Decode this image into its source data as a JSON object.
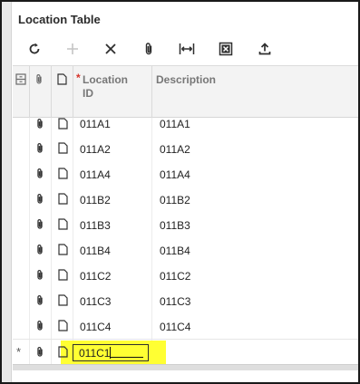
{
  "panel": {
    "title": "Location Table"
  },
  "toolbar": {
    "buttons": [
      {
        "name": "refresh-button",
        "icon": "refresh-icon",
        "enabled": true
      },
      {
        "name": "add-row-button",
        "icon": "plus-icon",
        "enabled": false
      },
      {
        "name": "delete-row-button",
        "icon": "close-icon",
        "enabled": true
      },
      {
        "name": "attach-button",
        "icon": "paperclip-icon",
        "enabled": true
      },
      {
        "name": "fit-columns-button",
        "icon": "fit-width-icon",
        "enabled": true
      },
      {
        "name": "export-excel-button",
        "icon": "excel-icon",
        "enabled": true
      },
      {
        "name": "upload-button",
        "icon": "upload-icon",
        "enabled": true
      }
    ]
  },
  "table": {
    "columns": {
      "location_id_line1": "Location",
      "location_id_line2": "ID",
      "description": "Description"
    },
    "rows": [
      {
        "location_id": "011A1",
        "description": "011A1"
      },
      {
        "location_id": "011A2",
        "description": "011A2"
      },
      {
        "location_id": "011A4",
        "description": "011A4"
      },
      {
        "location_id": "011B2",
        "description": "011B2"
      },
      {
        "location_id": "011B3",
        "description": "011B3"
      },
      {
        "location_id": "011B4",
        "description": "011B4"
      },
      {
        "location_id": "011C2",
        "description": "011C2"
      },
      {
        "location_id": "011C3",
        "description": "011C3"
      },
      {
        "location_id": "011C4",
        "description": "011C4"
      }
    ],
    "new_row": {
      "marker": "*",
      "location_id_value": "011C1"
    }
  },
  "colors": {
    "highlight": "#ffff33",
    "required": "#d6332a"
  }
}
